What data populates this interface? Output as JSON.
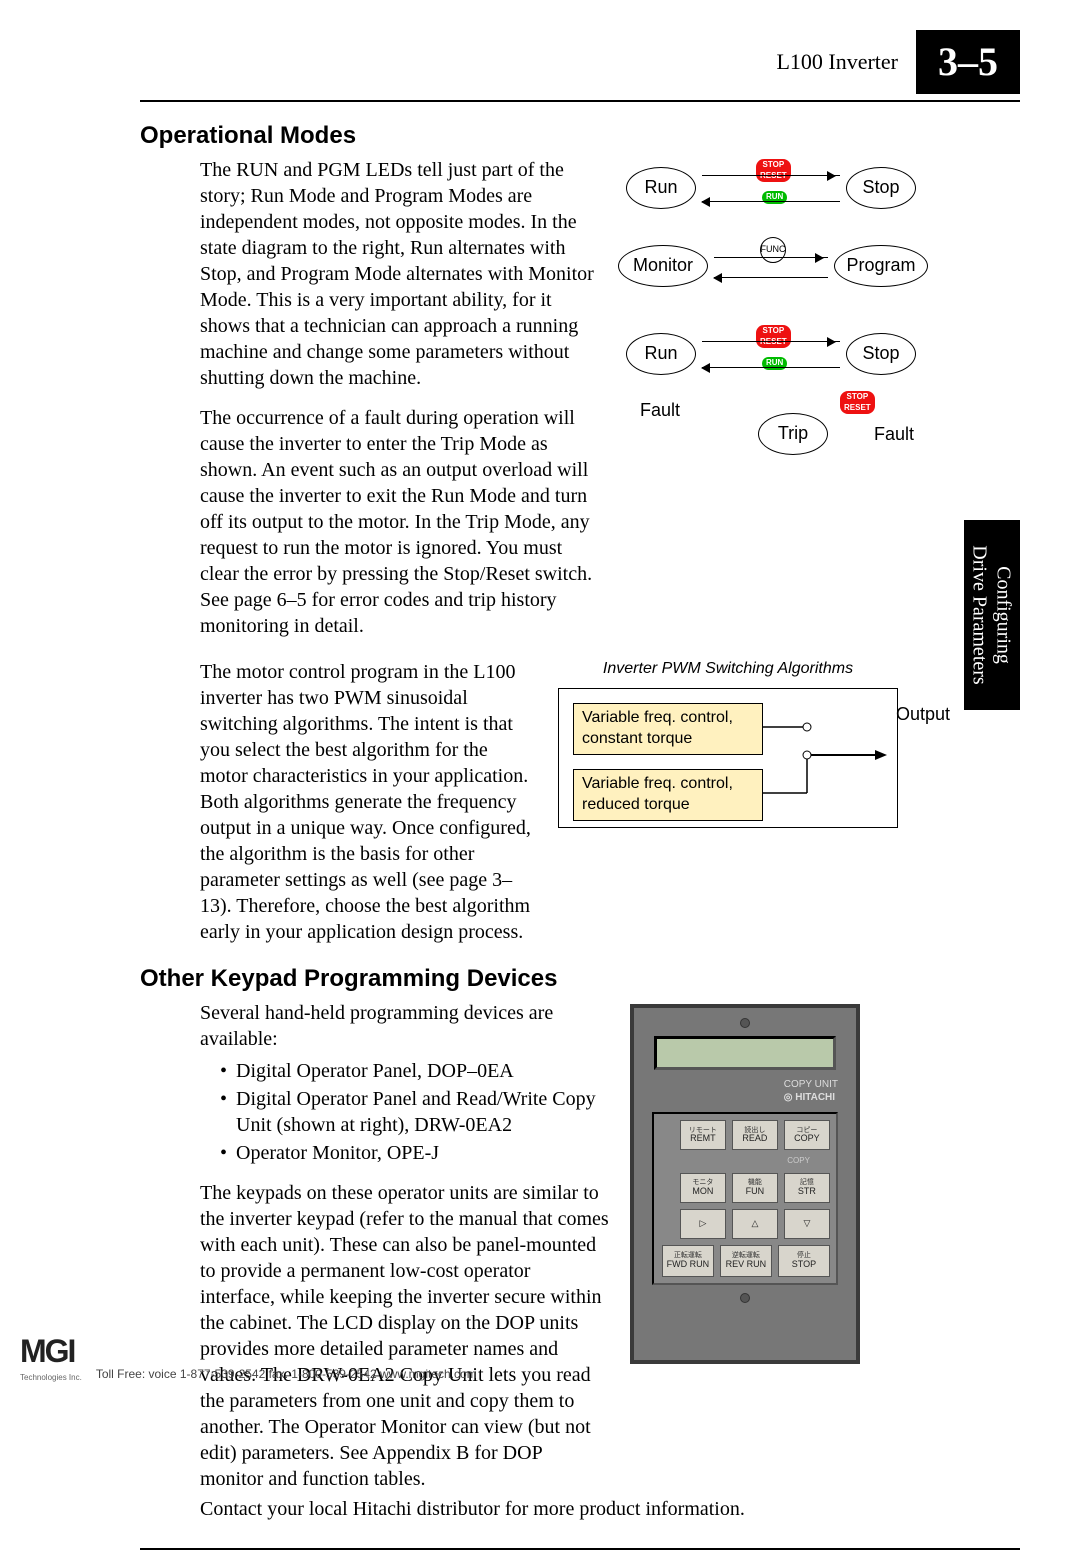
{
  "header": {
    "doc": "L100 Inverter",
    "page": "3–5"
  },
  "side_tab": {
    "line1": "Configuring",
    "line2": "Drive Parameters"
  },
  "section1": {
    "heading": "Operational Modes",
    "p1": "The RUN and PGM LEDs tell just part of the story; Run Mode and Program Modes are independent modes, not opposite modes. In the state diagram to the right, Run alternates with Stop, and Program Mode alternates with Monitor Mode. This is a very important ability, for it shows that a technician can approach a running machine and change some parameters without shutting down the machine.",
    "p2": "The occurrence of a fault during operation will cause the inverter to enter the Trip Mode as shown. An event such as an output overload will cause the inverter to exit the Run Mode and turn off its output to the motor. In the Trip Mode, any request to run the motor is ignored. You must clear the error by pressing the Stop/Reset switch. See page 6–5 for error codes and trip history monitoring in detail.",
    "p3": "The motor control program in the L100 inverter has two PWM sinusoidal switching algorithms. The intent is that you select the best algorithm for the motor characteristics in your application. Both algorithms generate the frequency output in a unique way. Once configured, the algorithm is the basis for other parameter settings as well (see page 3–13). Therefore, choose the best algorithm early in your application design process."
  },
  "diagram": {
    "run": "Run",
    "stop": "Stop",
    "monitor": "Monitor",
    "program": "Program",
    "trip": "Trip",
    "fault": "Fault",
    "btn_stop": "STOP",
    "btn_reset": "RESET",
    "btn_run": "RUN",
    "btn_func": "FUNC"
  },
  "pwm": {
    "title": "Inverter PWM Switching Algorithms",
    "alg1a": "Variable freq. control,",
    "alg1b": "constant torque",
    "alg2a": "Variable freq. control,",
    "alg2b": "reduced  torque",
    "output": "Output"
  },
  "section2": {
    "heading": "Other Keypad Programming Devices",
    "intro": "Several hand-held programming devices are available:",
    "bullets": [
      "Digital Operator Panel, DOP–0EA",
      "Digital Operator Panel and Read/Write Copy Unit (shown at right), DRW-0EA2",
      "Operator Monitor, OPE-J"
    ],
    "para": "The keypads on these operator units are similar to the inverter keypad (refer to the manual that comes with each unit). These can also be panel-mounted to provide a permanent low-cost operator interface, while keeping the inverter secure within the cabinet. The LCD display on the DOP units provides more detailed parameter names and values. The DRW-0EA2 Copy Unit lets you read the parameters from one unit and copy them to another. The Operator Monitor can view (but not edit) parameters. See Appendix B for DOP monitor and function tables.",
    "final": "Contact your local Hitachi distributor for more product information."
  },
  "device": {
    "copy_unit": "COPY  UNIT",
    "brand": "HITACHI",
    "copy_arrow": "COPY",
    "keys": {
      "remt": "REMT",
      "read": "READ",
      "copy": "COPY",
      "mon": "MON",
      "fun": "FUN",
      "str": "STR",
      "fwd": "FWD RUN",
      "rev": "REV RUN",
      "stop": "STOP"
    },
    "jp": {
      "remt": "リモート",
      "read": "読出し",
      "copy": "コピー",
      "mon": "モニタ",
      "fun": "機能",
      "str": "記憶",
      "fwd": "正転運転",
      "rev": "逆転運転",
      "stop": "停止"
    }
  },
  "footer": {
    "logo": "MGI",
    "logo_sub": "Technologies Inc.",
    "text": "Toll Free:  voice 1-877-539-2542  fax: 1-800-539-2542  www.mgitech.com"
  }
}
